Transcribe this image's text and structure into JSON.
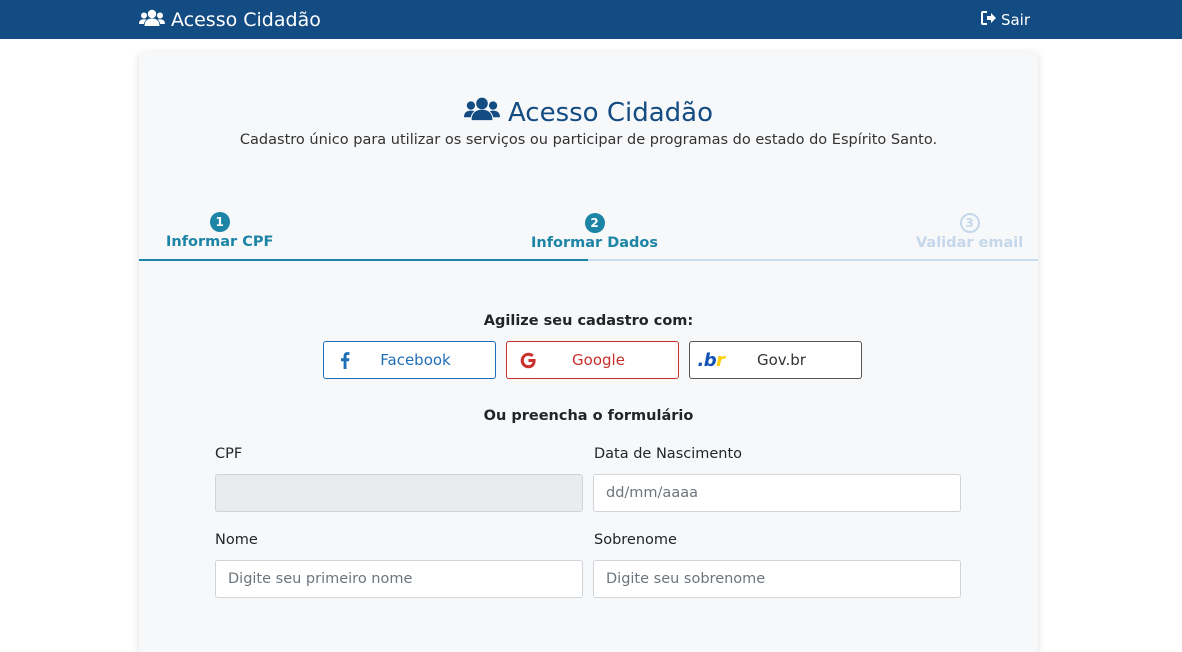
{
  "navbar": {
    "brand": "Acesso Cidadão",
    "logout_label": "Sair"
  },
  "header": {
    "title": "Acesso Cidadão",
    "subtitle": "Cadastro único para utilizar os serviços ou participar de programas do estado do Espírito Santo."
  },
  "steps": [
    {
      "number": "1",
      "label": "Informar CPF",
      "state": "done"
    },
    {
      "number": "2",
      "label": "Informar Dados",
      "state": "current"
    },
    {
      "number": "3",
      "label": "Validar email",
      "state": "todo"
    }
  ],
  "quick_signup": {
    "title": "Agilize seu cadastro com:",
    "facebook_label": "Facebook",
    "google_label": "Google",
    "govbr_label": "Gov.br",
    "govbr_logo": {
      "dot": ".",
      "b": "b",
      "r": "r"
    }
  },
  "form": {
    "title": "Ou preencha o formulário",
    "cpf_label": "CPF",
    "cpf_value": "",
    "birth_label": "Data de Nascimento",
    "birth_placeholder": "dd/mm/aaaa",
    "first_name_label": "Nome",
    "first_name_placeholder": "Digite seu primeiro nome",
    "last_name_label": "Sobrenome",
    "last_name_placeholder": "Digite seu sobrenome"
  },
  "colors": {
    "navbar": "#134c82",
    "step_active": "#1c85a6",
    "step_inactive": "#c5d7ea",
    "facebook": "#1f6fb8",
    "google": "#c9302c"
  },
  "icons": {
    "brand": "users-icon",
    "logout": "sign-out-icon",
    "facebook": "facebook-icon",
    "google": "google-icon",
    "govbr": "govbr-logo"
  }
}
